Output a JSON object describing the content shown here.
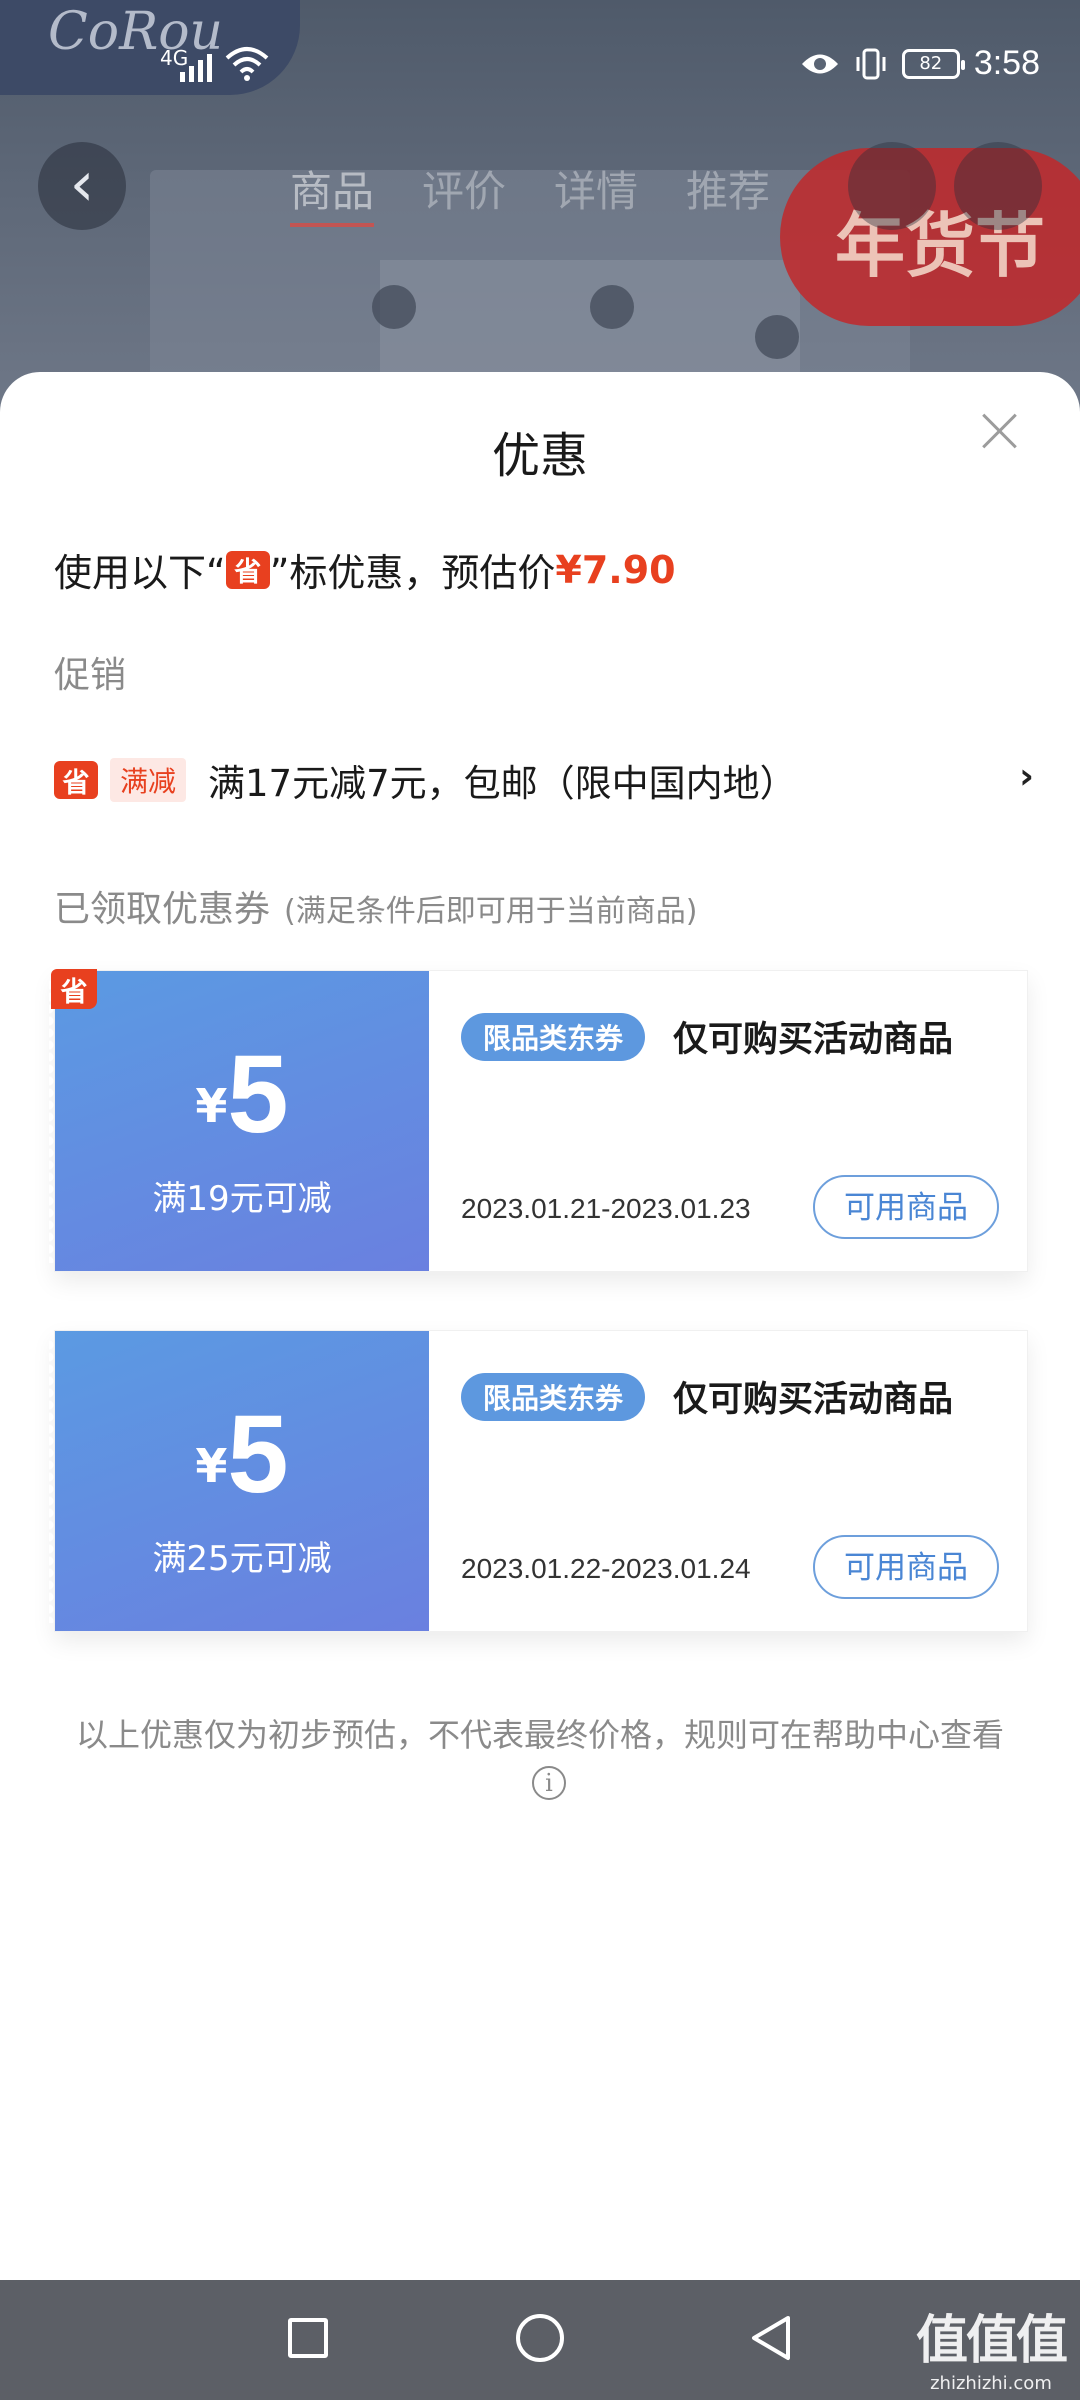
{
  "background": {
    "brand_text": "CoRou",
    "tabs": [
      "商品",
      "评价",
      "详情",
      "推荐"
    ],
    "festival_badge": "年货节"
  },
  "status_bar": {
    "network": "4G",
    "battery": "82",
    "time": "3:58"
  },
  "sheet": {
    "title": "优惠",
    "estimate": {
      "prefix": "使用以下“",
      "badge": "省",
      "suffix": "”标优惠，预估价",
      "price": "¥7.90"
    },
    "promo_section": {
      "label": "促销",
      "item": {
        "badge": "省",
        "tag": "满减",
        "text": "满17元减7元，包邮（限中国内地）"
      }
    },
    "coupon_section": {
      "label": "已领取优惠券",
      "sublabel": "(满足条件后即可用于当前商品)"
    },
    "coupons": [
      {
        "badge": "省",
        "yen": "¥",
        "amount": "5",
        "condition": "满19元可减",
        "tag": "限品类东券",
        "title": "仅可购买活动商品",
        "date": "2023.01.21-2023.01.23",
        "button": "可用商品"
      },
      {
        "badge": "",
        "yen": "¥",
        "amount": "5",
        "condition": "满25元可减",
        "tag": "限品类东券",
        "title": "仅可购买活动商品",
        "date": "2023.01.22-2023.01.24",
        "button": "可用商品"
      }
    ],
    "footer_note": "以上优惠仅为初步预估，不代表最终价格，规则可在帮助中心查看"
  },
  "watermark": {
    "main": "值值值",
    "sub": "zhizhizhi.com"
  },
  "colors": {
    "accent_red": "#e8401f",
    "coupon_blue": "#5b9ae2",
    "tag_blue": "#5d98df"
  }
}
